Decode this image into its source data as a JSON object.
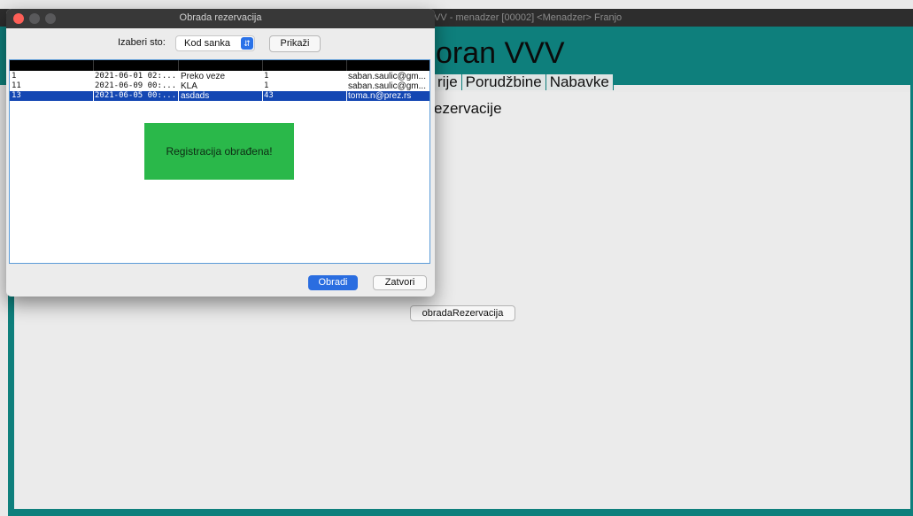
{
  "main_window": {
    "title": "VV - menadzer [00002] <Menadzer> Franjo",
    "logo": "oran VVV",
    "menu": [
      "rije",
      "Porudžbine",
      "Nabavke"
    ],
    "heading": "ezervacije",
    "obrada_button": "obradaRezervacija"
  },
  "dialog": {
    "title": "Obrada rezervacija",
    "table_label": "Izaberi sto:",
    "table_select_value": "Kod sanka",
    "show_button": "Prikaži",
    "rows": [
      {
        "c1": "1",
        "c2": "2021-06-01 02:...",
        "c3": "Preko veze",
        "c4": "1",
        "c5": "saban.saulic@gm..."
      },
      {
        "c1": "11",
        "c2": "2021-06-09 00:...",
        "c3": "KLA",
        "c4": "1",
        "c5": "saban.saulic@gm..."
      },
      {
        "c1": "13",
        "c2": "2021-06-05 00:...",
        "c3": "asdads",
        "c4": "43",
        "c5": "toma.n@prez.rs"
      }
    ],
    "toast": "Registracija obrađena!",
    "process_button": "Obradi",
    "close_button": "Zatvori"
  },
  "colors": {
    "teal": "#0e7f7c",
    "selection": "#1447b3",
    "toast_bg": "#2ab84a",
    "primary_button": "#2a6de0",
    "close_dot": "#fe5f57"
  }
}
